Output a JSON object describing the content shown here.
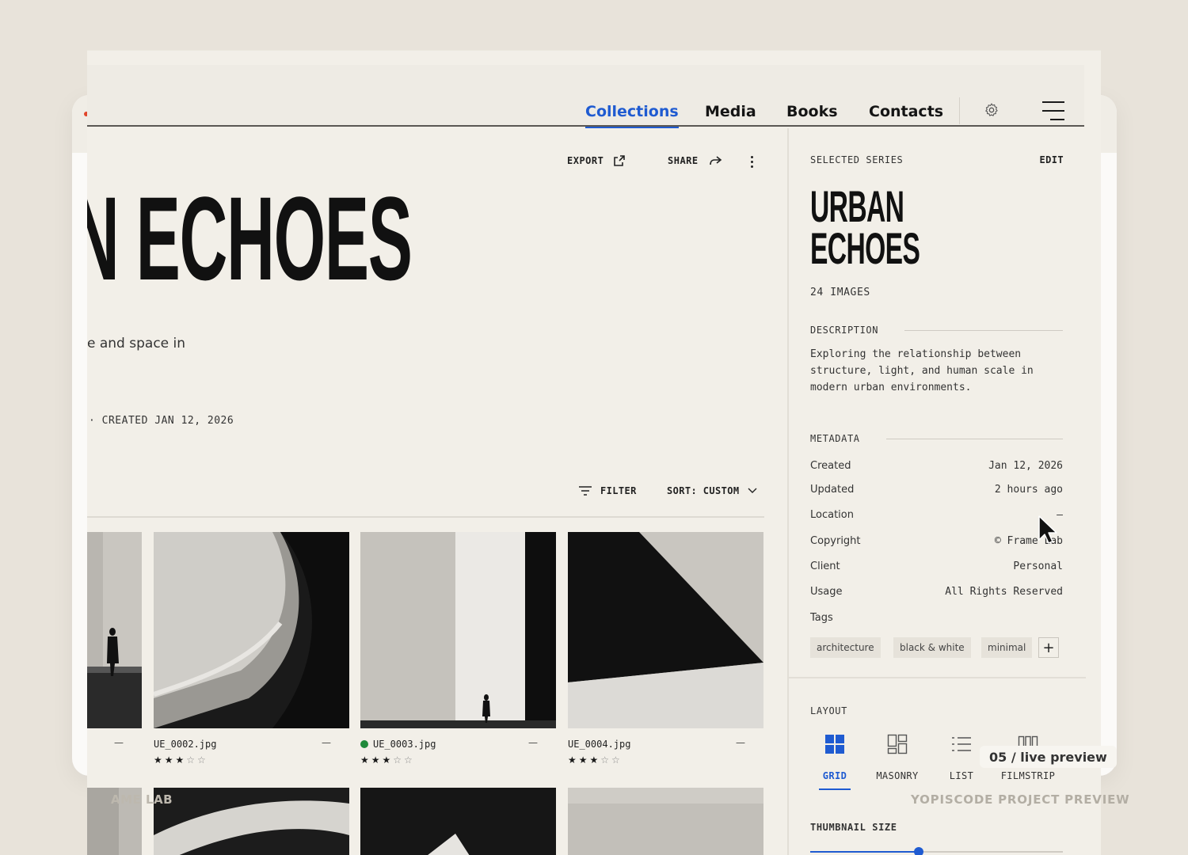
{
  "nav": {
    "links": [
      "Collections",
      "Media",
      "Books",
      "Contacts"
    ],
    "active": "Collections"
  },
  "icons": {
    "settings": "gear-icon",
    "menu": "hamburger-menu-icon",
    "export": "export-icon",
    "share": "share-arrow-icon",
    "more": "kebab-more-icon",
    "filter": "filter-lines-icon",
    "sort": "chevron-down-icon",
    "add_tag": "plus-icon",
    "cursor": "mouse-pointer-icon"
  },
  "toolbar": {
    "export_label": "EXPORT",
    "share_label": "SHARE"
  },
  "hero": {
    "title": "N ECHOES",
    "subtitle": "e and space in",
    "meta": "·  CREATED JAN 12, 2026"
  },
  "grid": {
    "filter_label": "FILTER",
    "sort_label": "SORT: CUSTOM",
    "items": [
      {
        "filename": "",
        "dash": "—",
        "rating": 0,
        "status": ""
      },
      {
        "filename": "UE_0002.jpg",
        "dash": "—",
        "rating": 3,
        "status": ""
      },
      {
        "filename": "UE_0003.jpg",
        "dash": "—",
        "rating": 3,
        "status": "green"
      },
      {
        "filename": "UE_0004.jpg",
        "dash": "—",
        "rating": 3,
        "status": ""
      }
    ]
  },
  "sidebar": {
    "section_label": "SELECTED SERIES",
    "edit_label": "EDIT",
    "title_line1": "URBAN",
    "title_line2": "ECHOES",
    "count": "24 IMAGES",
    "description_label": "DESCRIPTION",
    "description": "Exploring the relationship between structure, light, and human scale in modern urban environments.",
    "metadata_label": "METADATA",
    "metadata": [
      {
        "key": "Created",
        "value": "Jan 12, 2026"
      },
      {
        "key": "Updated",
        "value": "2 hours ago"
      },
      {
        "key": "Location",
        "value": "—"
      },
      {
        "key": "Copyright",
        "value": "© Frame Lab"
      },
      {
        "key": "Client",
        "value": "Personal"
      },
      {
        "key": "Usage",
        "value": "All Rights Reserved"
      },
      {
        "key": "Tags",
        "value": ""
      }
    ],
    "tags": [
      "architecture",
      "black & white",
      "minimal"
    ],
    "add_tag": "+",
    "layout_label": "LAYOUT",
    "layouts": [
      "GRID",
      "MASONRY",
      "LIST",
      "FILMSTRIP"
    ],
    "active_layout": "GRID",
    "thumb_size_label": "THUMBNAIL SIZE",
    "thumb_size": 0.43
  },
  "overlay": {
    "live_badge": "05 / live preview",
    "footer_left": "AME LAB",
    "footer_right": "YOPISCODE PROJECT PREVIEW"
  },
  "colors": {
    "accent": "#1f5bd1",
    "status_green": "#1f8a3a",
    "page_bg": "#e8e3da",
    "window_bg": "#f2efe8"
  }
}
